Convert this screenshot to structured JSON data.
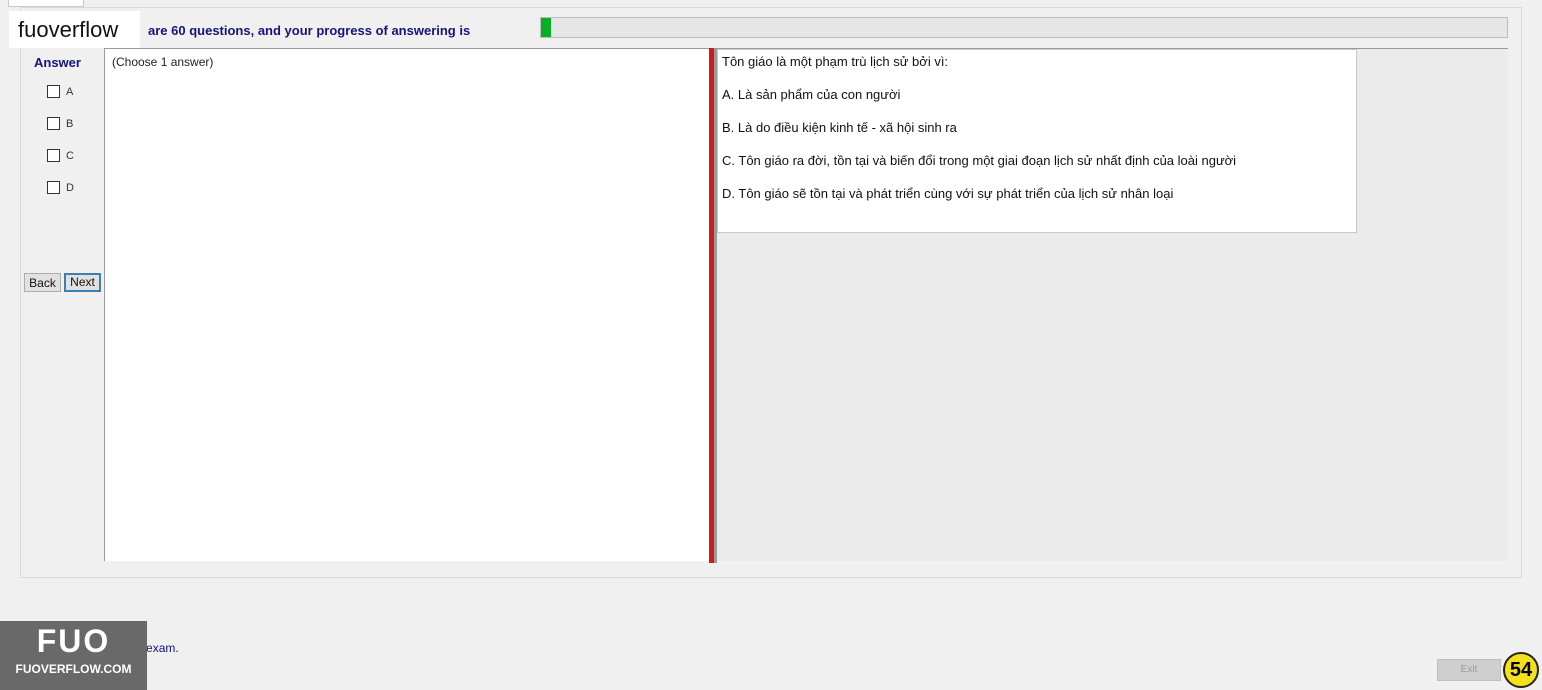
{
  "header": {
    "brand": "fuoverflow",
    "progress_text": "are 60 questions, and your progress of answering is",
    "progress_fraction": 0.01
  },
  "answer_panel": {
    "title": "Answer",
    "options": [
      "A",
      "B",
      "C",
      "D"
    ],
    "back_label": "Back",
    "next_label": "Next"
  },
  "left_pane": {
    "instruction": "(Choose 1 answer)"
  },
  "question": {
    "stem": "Tôn giáo là một phạm trù lịch sử bởi vì:",
    "choices": [
      "A.  Là sản phẩm của con người",
      "B.  Là do điều kiện kinh tế - xã hội sinh ra",
      "C.  Tôn giáo ra đời, tồn tại và biến đổi trong một giai đoạn lịch sử nhất định của loài người",
      "D.  Tôn giáo sẽ tồn tại và phát triển cùng với sự phát triển của lịch sử nhân loại"
    ]
  },
  "footer": {
    "finish_text": "I want to finish the exam.",
    "watermark_big": "FUO",
    "watermark_small": "FUOVERFLOW.COM",
    "exit_label": "Exit",
    "page_badge": "54"
  }
}
